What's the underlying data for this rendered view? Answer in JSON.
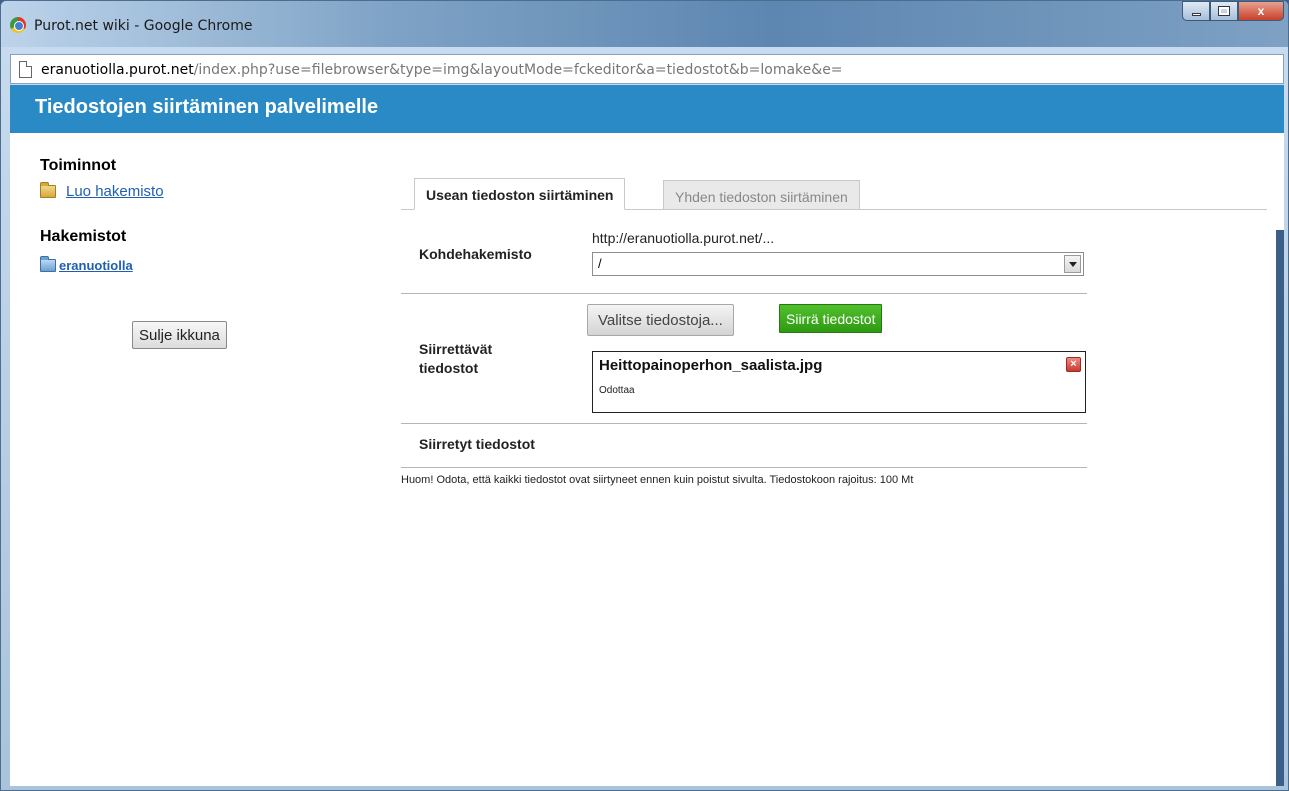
{
  "window": {
    "title": "Purot.net wiki - Google Chrome",
    "controls": {
      "minimize": "minimize",
      "maximize": "maximize",
      "close": "x"
    }
  },
  "address": {
    "host": "eranuotiolla.purot.net",
    "path": "/index.php?use=filebrowser&type=img&layoutMode=fckeditor&a=tiedostot&b=lomake&e="
  },
  "page": {
    "header": "Tiedostojen siirtäminen palvelimelle"
  },
  "sidebar": {
    "actions_heading": "Toiminnot",
    "create_folder": "Luo hakemisto",
    "folders_heading": "Hakemistot",
    "folder_root": "eranuotiolla",
    "close_button": "Sulje ikkuna"
  },
  "tabs": [
    {
      "label": "Usean tiedoston siirtäminen",
      "active": true
    },
    {
      "label": "Yhden tiedoston siirtäminen",
      "active": false
    }
  ],
  "form": {
    "target_label": "Kohdehakemisto",
    "target_url": "http://eranuotiolla.purot.net/...",
    "target_value": "/",
    "files_label_line1": "Siirrettävät",
    "files_label_line2": "tiedostot",
    "choose_button": "Valitse tiedostoja...",
    "upload_button": "Siirrä tiedostot",
    "queued_file": {
      "name": "Heittopainoperhon_saalista.jpg",
      "status": "Odottaa"
    },
    "uploaded_label": "Siirretyt tiedostot",
    "note": "Huom! Odota, että kaikki tiedostot ovat siirtyneet ennen kuin poistut sivulta. Tiedostokoon rajoitus: 100 Mt"
  },
  "colors": {
    "header": "#2a8ac6",
    "upload_button": "#3aa81c",
    "link": "#1f5fb3"
  }
}
